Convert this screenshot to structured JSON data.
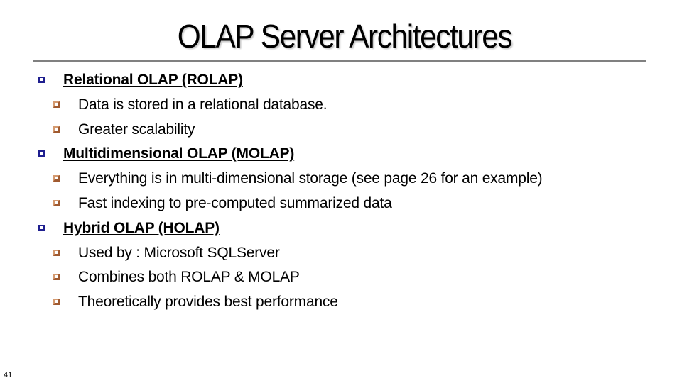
{
  "slide": {
    "title": "OLAP Server Architectures",
    "page_number": "41",
    "colors": {
      "level1_bullet": "#1f1f8f",
      "level2_bullet": "#b06a3a",
      "rule": "#808080"
    },
    "bullets": [
      {
        "level": 1,
        "icon": "square-bullet-icon",
        "text": "Relational OLAP (ROLAP)"
      },
      {
        "level": 2,
        "icon": "square-bullet-icon",
        "text": "Data is stored in a  relational database."
      },
      {
        "level": 2,
        "icon": "square-bullet-icon",
        "text": "Greater scalability"
      },
      {
        "level": 1,
        "icon": "square-bullet-icon",
        "text": "Multidimensional OLAP (MOLAP)"
      },
      {
        "level": 2,
        "icon": "square-bullet-icon",
        "text": "Everything is in multi-dimensional storage (see page 26 for an example)"
      },
      {
        "level": 2,
        "icon": "square-bullet-icon",
        "text": "Fast indexing to pre-computed summarized data"
      },
      {
        "level": 1,
        "icon": "square-bullet-icon",
        "text": "Hybrid OLAP (HOLAP)"
      },
      {
        "level": 2,
        "icon": "square-bullet-icon",
        "text": "Used by : Microsoft SQLServer"
      },
      {
        "level": 2,
        "icon": "square-bullet-icon",
        "text": "Combines both ROLAP & MOLAP"
      },
      {
        "level": 2,
        "icon": "square-bullet-icon",
        "text": "Theoretically provides best performance"
      }
    ]
  }
}
